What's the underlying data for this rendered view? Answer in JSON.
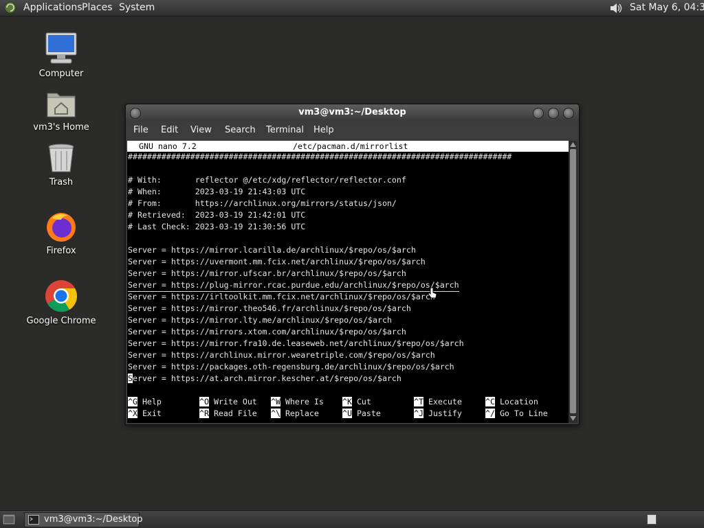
{
  "top_panel": {
    "menus": [
      "Applications",
      "Places",
      "System"
    ],
    "clock": "Sat May  6, 04:33"
  },
  "desktop_icons": {
    "computer": "Computer",
    "home": "vm3's Home",
    "trash": "Trash",
    "firefox": "Firefox",
    "chrome": "Google Chrome"
  },
  "window": {
    "title": "vm3@vm3:~/Desktop",
    "menu": [
      "File",
      "Edit",
      "View",
      "Search",
      "Terminal",
      "Help"
    ]
  },
  "nano": {
    "version": "GNU nano 7.2",
    "filename": "/etc/pacman.d/mirrorlist",
    "hash_line": "################################################################################",
    "lines": [
      "",
      "# With:       reflector @/etc/xdg/reflector/reflector.conf",
      "# When:       2023-03-19 21:43:03 UTC",
      "# From:       https://archlinux.org/mirrors/status/json/",
      "# Retrieved:  2023-03-19 21:42:01 UTC",
      "# Last Check: 2023-03-19 21:30:56 UTC",
      "",
      "Server = https://mirror.lcarilla.de/archlinux/$repo/os/$arch",
      "Server = https://uvermont.mm.fcix.net/archlinux/$repo/os/$arch",
      "Server = https://mirror.ufscar.br/archlinux/$repo/os/$arch",
      "Server = https://plug-mirror.rcac.purdue.edu/archlinux/$repo/os/$arch",
      "Server = https://irltoolkit.mm.fcix.net/archlinux/$repo/os/$arch",
      "Server = https://mirror.theo546.fr/archlinux/$repo/os/$arch",
      "Server = https://mirror.lty.me/archlinux/$repo/os/$arch",
      "Server = https://mirrors.xtom.com/archlinux/$repo/os/$arch",
      "Server = https://mirror.fra10.de.leaseweb.net/archlinux/$repo/os/$arch",
      "Server = https://archlinux.mirror.wearetriple.com/$repo/os/$arch",
      "Server = https://packages.oth-regensburg.de/archlinux/$repo/os/$arch"
    ],
    "last_line_first_char": "S",
    "last_line_rest": "erver = https://at.arch.mirror.kescher.at/$repo/os/$arch",
    "shortcuts_row1": [
      {
        "key": "^G",
        "label": "Help"
      },
      {
        "key": "^O",
        "label": "Write Out"
      },
      {
        "key": "^W",
        "label": "Where Is"
      },
      {
        "key": "^K",
        "label": "Cut"
      },
      {
        "key": "^T",
        "label": "Execute"
      },
      {
        "key": "^C",
        "label": "Location"
      }
    ],
    "shortcuts_row2": [
      {
        "key": "^X",
        "label": "Exit"
      },
      {
        "key": "^R",
        "label": "Read File"
      },
      {
        "key": "^\\",
        "label": "Replace"
      },
      {
        "key": "^U",
        "label": "Paste"
      },
      {
        "key": "^J",
        "label": "Justify"
      },
      {
        "key": "^/",
        "label": "Go To Line"
      }
    ]
  },
  "taskbar": {
    "window_button": "vm3@vm3:~/Desktop"
  }
}
